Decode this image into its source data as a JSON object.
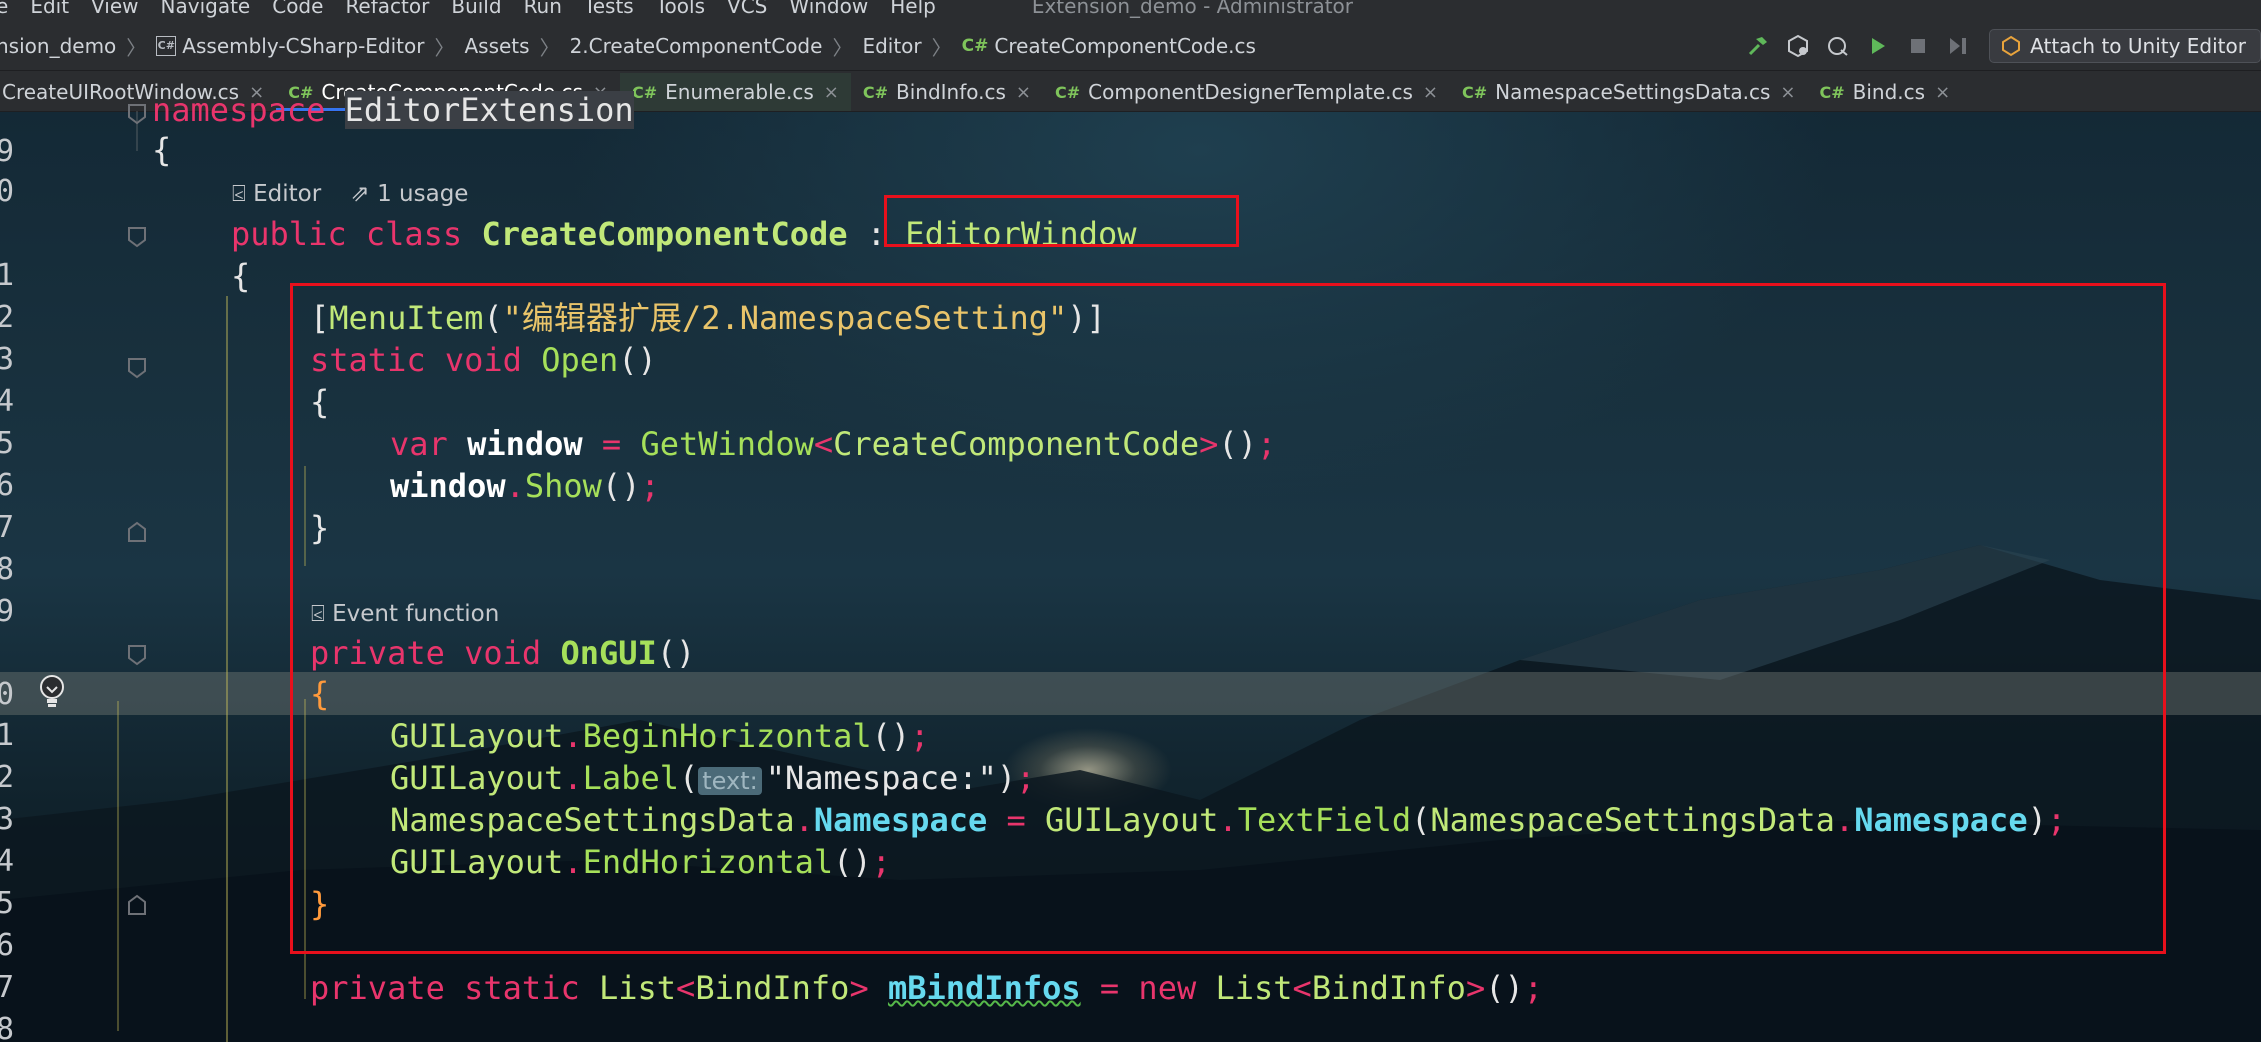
{
  "menu": {
    "items": [
      "e",
      "Edit",
      "View",
      "Navigate",
      "Code",
      "Refactor",
      "Build",
      "Run",
      "Tests",
      "Tools",
      "VCS",
      "Window",
      "Help"
    ],
    "window_title": "Extension_demo - Administrator"
  },
  "breadcrumb": {
    "project": "nsion_demo",
    "assembly": "Assembly-CSharp-Editor",
    "folder1": "Assets",
    "folder2": "2.CreateComponentCode",
    "folder3": "Editor",
    "file": "CreateComponentCode.cs"
  },
  "toolbar": {
    "attach_label": "Attach to Unity Editor"
  },
  "tabs": [
    {
      "label": "CreateUIRootWindow.cs",
      "close": "×"
    },
    {
      "label": "CreateComponentCode.cs",
      "close": "×"
    },
    {
      "label": "Enumerable.cs",
      "close": "×"
    },
    {
      "label": "BindInfo.cs",
      "close": "×"
    },
    {
      "label": "ComponentDesignerTemplate.cs",
      "close": "×"
    },
    {
      "label": "NamespaceSettingsData.cs",
      "close": "×"
    },
    {
      "label": "Bind.cs",
      "close": "×"
    }
  ],
  "hints": {
    "editor_scope": "Editor",
    "usages": "1 usage",
    "event_function": "Event function",
    "param_inlay": "text:"
  },
  "line_numbers": [
    "9",
    "0",
    "1",
    "2",
    "3",
    "4",
    "5",
    "6",
    "7",
    "8",
    "9",
    "0",
    "1",
    "2",
    "3",
    "4",
    "5",
    "6",
    "7",
    "8"
  ],
  "code": {
    "l9_kw": "namespace",
    "l9_name": "EditorExtension",
    "open_brace": "{",
    "close_brace": "}",
    "l11_public": "public",
    "l11_class": "class",
    "l11_name": "CreateComponentCode",
    "l11_colon": ":",
    "l11_base": "EditorWindow",
    "l13_lb": "[",
    "l13_attr": "MenuItem",
    "l13_lp": "(",
    "l13_str": "\"编辑器扩展/2.NamespaceSetting\"",
    "l13_rp": ")]",
    "l14_static": "static",
    "l14_void": "void",
    "l14_fn": "Open",
    "l14_parens": "()",
    "l16_var": "var",
    "l16_window": "window",
    "l16_eq": "=",
    "l16_fn": "GetWindow",
    "l16_lt": "<",
    "l16_type": "CreateComponentCode",
    "l16_gt": ">",
    "l16_call": "()",
    "l16_semi": ";",
    "l17_window": "window",
    "l17_dot": ".",
    "l17_fn": "Show",
    "l17_call": "()",
    "l17_semi": ";",
    "l20_private": "private",
    "l20_void": "void",
    "l20_fn": "OnGUI",
    "l20_parens": "()",
    "gui": "GUILayout",
    "dot": ".",
    "semi": ";",
    "l22_fn": "BeginHorizontal",
    "l22_call": "()",
    "l23_fn": "Label",
    "l23_lp": "(",
    "l23_str": "\"Namespace:\"",
    "l23_rp": ")",
    "l24_cls": "NamespaceSettingsData",
    "l24_prop": "Namespace",
    "l24_eq": "=",
    "l24_fn": "TextField",
    "l24_lp": "(",
    "l24_rp": ")",
    "l25_fn": "EndHorizontal",
    "l25_call": "()",
    "l28_private": "private",
    "l28_static": "static",
    "l28_list": "List",
    "l28_lt": "<",
    "l28_bind": "BindInfo",
    "l28_gt": ">",
    "l28_field": "mBindInfos",
    "l28_eq": "=",
    "l28_new": "new",
    "l28_call": "()",
    "l28_semi": ";"
  },
  "colors": {
    "keyword": "#e8356c",
    "type": "#c1e879",
    "string": "#e9c46a",
    "property": "#66d9ef",
    "brace_highlight": "#ff9a3c",
    "annotation_box": "#e8101c",
    "active_tab_underline": "#3574f0"
  }
}
